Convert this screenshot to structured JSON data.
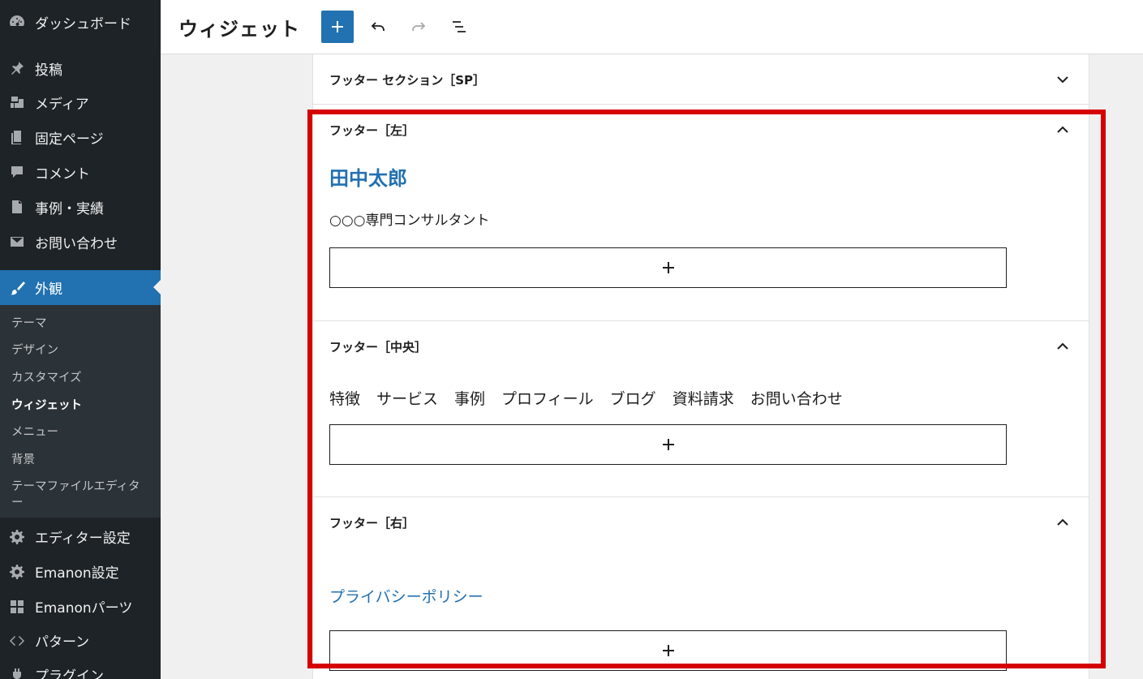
{
  "sidebar": {
    "menu_top": [
      {
        "label": "ダッシュボード",
        "icon": "dashboard-icon"
      },
      {
        "label": "投稿",
        "icon": "pin-icon"
      },
      {
        "label": "メディア",
        "icon": "media-icon"
      },
      {
        "label": "固定ページ",
        "icon": "pages-icon"
      },
      {
        "label": "コメント",
        "icon": "comment-icon"
      },
      {
        "label": "事例・実績",
        "icon": "document-icon"
      },
      {
        "label": "お問い合わせ",
        "icon": "mail-icon"
      }
    ],
    "appearance": {
      "label": "外観",
      "icon": "brush-icon"
    },
    "submenu": [
      "テーマ",
      "デザイン",
      "カスタマイズ",
      "ウィジェット",
      "メニュー",
      "背景",
      "テーマファイルエディター"
    ],
    "menu_bottom": [
      {
        "label": "エディター設定",
        "icon": "gear-icon"
      },
      {
        "label": "Emanon設定",
        "icon": "gear-icon"
      },
      {
        "label": "Emanonパーツ",
        "icon": "grid-icon"
      },
      {
        "label": "パターン",
        "icon": "diamond-icon"
      },
      {
        "label": "プラグイン",
        "icon": "plugin-icon"
      }
    ]
  },
  "header": {
    "title": "ウィジェット"
  },
  "areas": {
    "sp": {
      "title": "フッター セクション［SP］"
    },
    "left": {
      "title": "フッター［左］",
      "heading": "田中太郎",
      "text": "○○○専門コンサルタント"
    },
    "center": {
      "title": "フッター［中央］",
      "links": [
        "特徴",
        "サービス",
        "事例",
        "プロフィール",
        "ブログ",
        "資料請求",
        "お問い合わせ"
      ]
    },
    "right": {
      "title": "フッター［右］",
      "link": "プライバシーポリシー"
    }
  },
  "colors": {
    "accent": "#2271b1",
    "highlight": "#d50000",
    "sidebar": "#1d2327"
  }
}
